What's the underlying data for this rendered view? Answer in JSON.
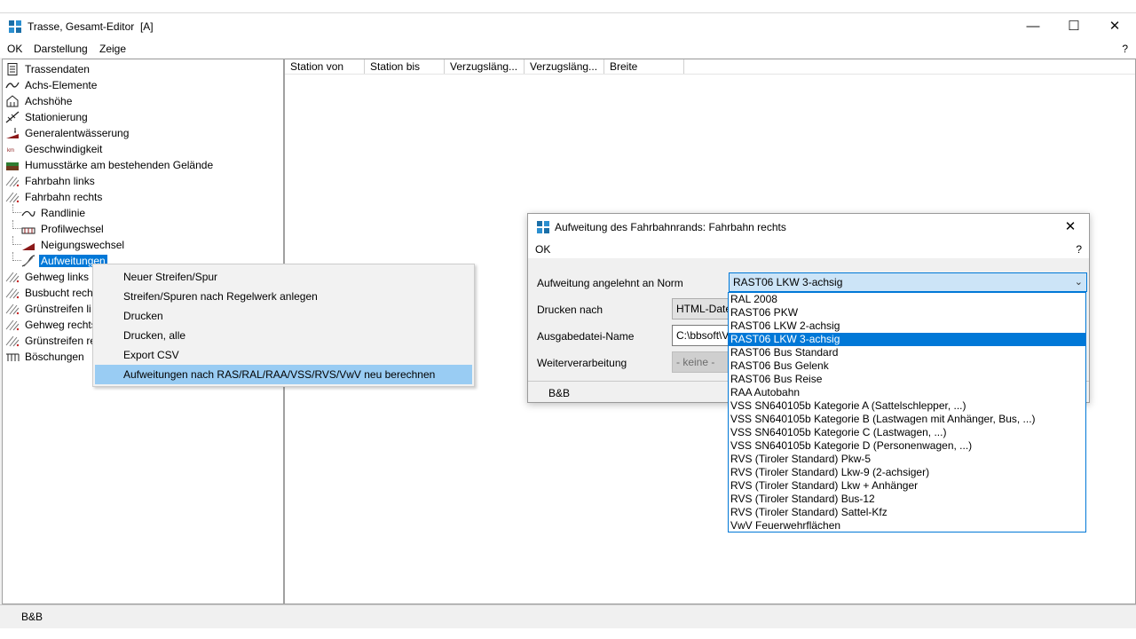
{
  "window": {
    "title": "Trasse, Gesamt-Editor",
    "title_badge": "[A]",
    "minimize_glyph": "—",
    "maximize_glyph": "☐",
    "close_glyph": "✕"
  },
  "menubar": {
    "items": [
      "OK",
      "Darstellung",
      "Zeige"
    ],
    "help": "?"
  },
  "tree": {
    "items": [
      {
        "label": "Trassendaten",
        "icon": "document-icon"
      },
      {
        "label": "Achs-Elemente",
        "icon": "curve-icon"
      },
      {
        "label": "Achshöhe",
        "icon": "building-icon"
      },
      {
        "label": "Stationierung",
        "icon": "stationing-icon"
      },
      {
        "label": "Generalentwässerung",
        "icon": "drainage-icon"
      },
      {
        "label": "Geschwindigkeit",
        "icon": "speed-km-icon"
      },
      {
        "label": "Humusstärke am bestehenden Gelände",
        "icon": "terrain-icon"
      },
      {
        "label": "Fahrbahn links",
        "icon": "roadway-icon"
      },
      {
        "label": "Fahrbahn rechts",
        "icon": "roadway-icon"
      },
      {
        "label": "Randlinie",
        "icon": "edge-line-icon"
      },
      {
        "label": "Profilwechsel",
        "icon": "profile-change-icon"
      },
      {
        "label": "Neigungswechsel",
        "icon": "slope-change-icon"
      },
      {
        "label": "Aufweitungen",
        "icon": "widening-icon"
      },
      {
        "label": "Gehweg links",
        "icon": "roadway-icon"
      },
      {
        "label": "Busbucht rech",
        "icon": "roadway-icon"
      },
      {
        "label": "Grünstreifen li",
        "icon": "roadway-icon"
      },
      {
        "label": "Gehweg rechts",
        "icon": "roadway-icon"
      },
      {
        "label": "Grünstreifen re",
        "icon": "roadway-icon"
      },
      {
        "label": "Böschungen",
        "icon": "embankment-icon"
      }
    ]
  },
  "table": {
    "columns": [
      "Station von",
      "Station bis",
      "Verzugsläng...",
      "Verzugsläng...",
      "Breite"
    ]
  },
  "status": {
    "text": "B&B"
  },
  "context_menu": {
    "items": [
      "Neuer Streifen/Spur",
      "Streifen/Spuren nach Regelwerk anlegen",
      "Drucken",
      "Drucken, alle",
      "Export CSV",
      "Aufweitungen nach RAS/RAL/RAA/VSS/RVS/VwV neu berechnen"
    ]
  },
  "dialog": {
    "title": "Aufweitung des Fahrbahnrands: Fahrbahn rechts",
    "close_glyph": "✕",
    "menu_ok": "OK",
    "menu_help": "?",
    "norm_label": "Aufweitung angelehnt an Norm",
    "norm_value": "RAST06 LKW 3-achsig",
    "print_label": "Drucken nach",
    "print_value": "HTML-Date",
    "output_label": "Ausgabedatei-Name",
    "output_value": "C:\\bbsoft\\V",
    "further_label": "Weiterverarbeitung",
    "further_value": "- keine -",
    "status": "B&B"
  },
  "dropdown": {
    "options": [
      "RAL 2008",
      "RAST06 PKW",
      "RAST06 LKW 2-achsig",
      "RAST06 LKW 3-achsig",
      "RAST06 Bus Standard",
      "RAST06 Bus Gelenk",
      "RAST06 Bus Reise",
      "RAA Autobahn",
      "VSS SN640105b Kategorie A (Sattelschlepper, ...)",
      "VSS SN640105b Kategorie B (Lastwagen mit Anhänger, Bus, ...)",
      "VSS SN640105b Kategorie C (Lastwagen, ...)",
      "VSS SN640105b Kategorie D (Personenwagen, ...)",
      "RVS (Tiroler Standard) Pkw-5",
      "RVS (Tiroler Standard) Lkw-9 (2-achsiger)",
      "RVS (Tiroler Standard) Lkw + Anhänger",
      "RVS (Tiroler Standard) Bus-12",
      "RVS (Tiroler Standard) Sattel-Kfz",
      "VwV Feuerwehrflächen"
    ],
    "selected_index": 3
  },
  "colors": {
    "selection": "#0078d7",
    "menu_highlight": "#99ccf3",
    "combo_focus": "#cce4f7"
  }
}
